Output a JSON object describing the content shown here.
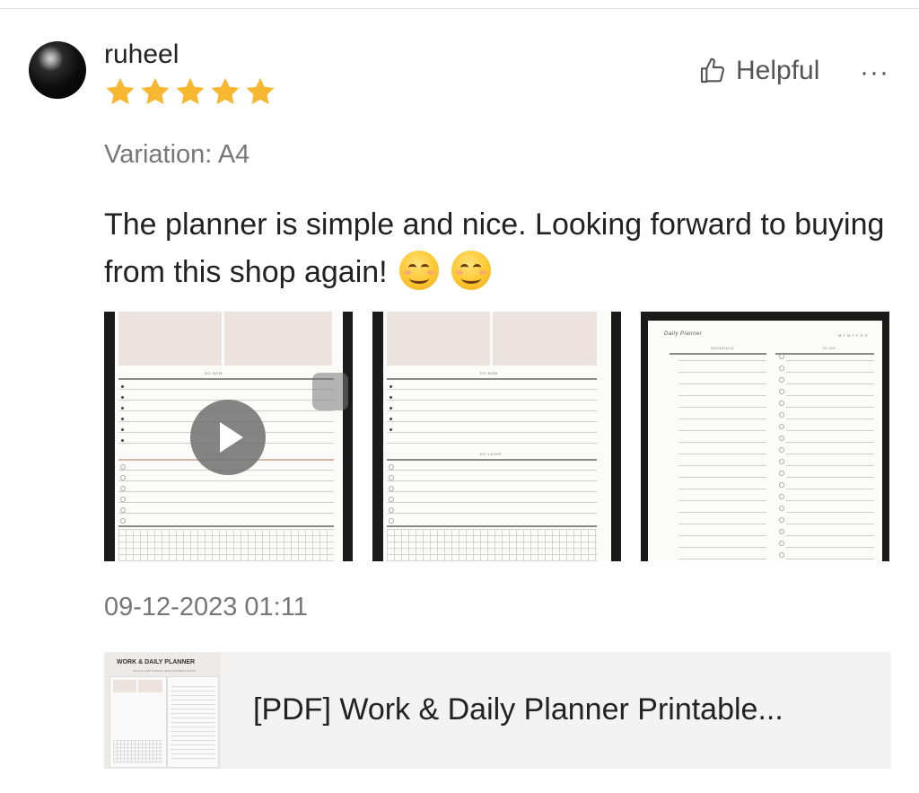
{
  "review": {
    "username": "ruheel",
    "rating": 5,
    "max_rating": 5,
    "helpful_label": "Helpful",
    "more_label": "···",
    "variation": "Variation: A4",
    "text": "The planner is simple and nice. Looking forward to buying from this shop again!",
    "emojis": [
      "smiling-face-emoji",
      "smiling-face-emoji"
    ],
    "timestamp": "09-12-2023 01:11",
    "star_color": "#F7B731"
  },
  "photos": [
    {
      "name": "review-video-1",
      "type": "video",
      "labels": [
        "DO NOW",
        "DO LATER"
      ]
    },
    {
      "name": "review-photo-2",
      "type": "image",
      "labels": [
        "DO NOW",
        "DO LATER"
      ]
    },
    {
      "name": "review-photo-3",
      "type": "image",
      "labels": [
        "Daily Planner",
        "SCHEDULE",
        "TO DO",
        "M T W T F S S"
      ]
    }
  ],
  "product": {
    "thumb_title": "WORK & DAILY PLANNER",
    "thumb_subtitle": "A5 & A4 | LEFT & RIGHT HAND | DOUBLE LAYOUT",
    "title": "[PDF] Work & Daily Planner Printable..."
  }
}
